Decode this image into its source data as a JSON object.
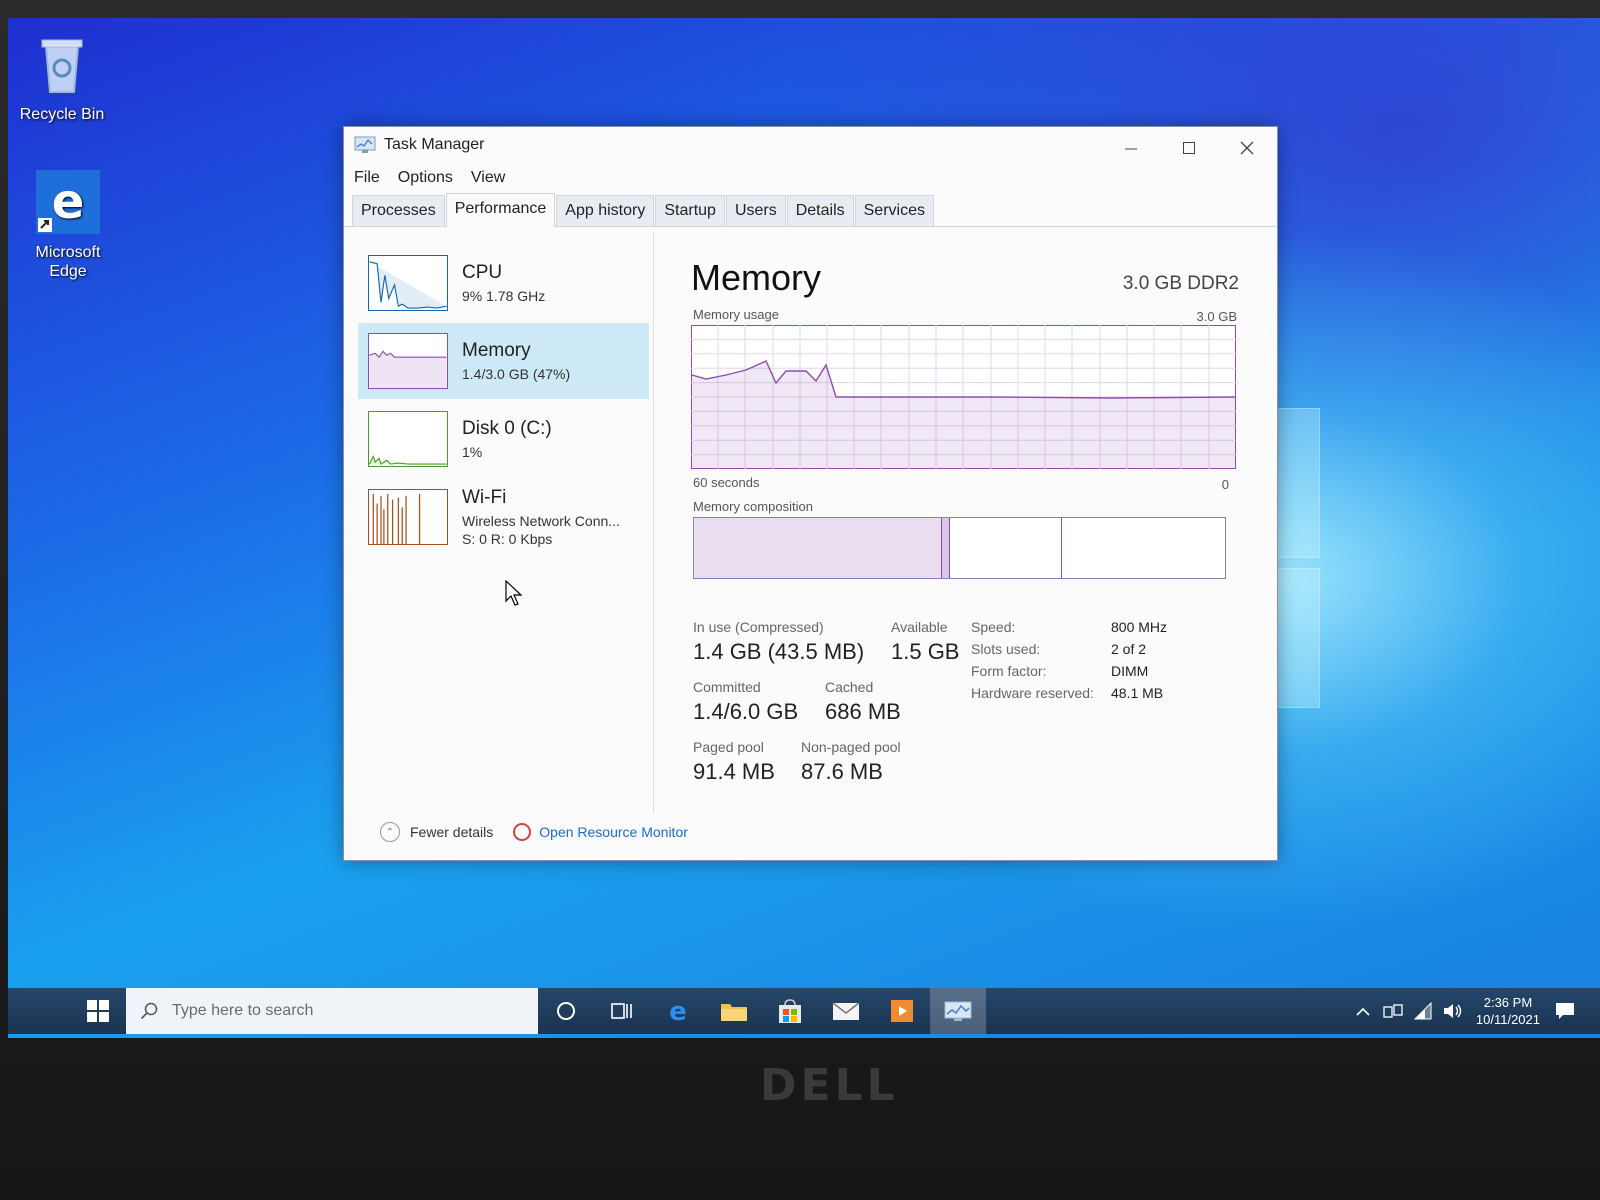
{
  "desktop": {
    "icons": [
      {
        "label": "Recycle Bin"
      },
      {
        "label": "Microsoft\nEdge"
      }
    ]
  },
  "task_manager": {
    "title": "Task Manager",
    "menu": [
      "File",
      "Options",
      "View"
    ],
    "tabs": [
      "Processes",
      "Performance",
      "App history",
      "Startup",
      "Users",
      "Details",
      "Services"
    ],
    "active_tab": "Performance",
    "sidebar": [
      {
        "title": "CPU",
        "line1": "9%  1.78 GHz",
        "line2": ""
      },
      {
        "title": "Memory",
        "line1": "1.4/3.0 GB (47%)",
        "line2": ""
      },
      {
        "title": "Disk 0 (C:)",
        "line1": "1%",
        "line2": ""
      },
      {
        "title": "Wi-Fi",
        "line1": "Wireless Network Conn...",
        "line2": "S: 0  R: 0 Kbps"
      }
    ],
    "main": {
      "title": "Memory",
      "spec": "3.0 GB DDR2",
      "usage_label": "Memory usage",
      "usage_max": "3.0 GB",
      "time_label": "60 seconds",
      "time_min": "0",
      "composition_label": "Memory composition",
      "stats": {
        "in_use_label": "In use (Compressed)",
        "in_use_value": "1.4 GB (43.5 MB)",
        "available_label": "Available",
        "available_value": "1.5 GB",
        "committed_label": "Committed",
        "committed_value": "1.4/6.0 GB",
        "cached_label": "Cached",
        "cached_value": "686 MB",
        "paged_label": "Paged pool",
        "paged_value": "91.4 MB",
        "nonpaged_label": "Non-paged pool",
        "nonpaged_value": "87.6 MB"
      },
      "specs": [
        {
          "k": "Speed:",
          "v": "800 MHz"
        },
        {
          "k": "Slots used:",
          "v": "2 of 2"
        },
        {
          "k": "Form factor:",
          "v": "DIMM"
        },
        {
          "k": "Hardware reserved:",
          "v": "48.1 MB"
        }
      ]
    },
    "footer": {
      "fewer_details": "Fewer details",
      "open_monitor": "Open Resource Monitor"
    }
  },
  "taskbar": {
    "search_placeholder": "Type here to search",
    "time": "2:36 PM",
    "date": "10/11/2021"
  },
  "colors": {
    "memory_accent": "#8b4db0",
    "cpu_accent": "#1168b5",
    "disk_accent": "#4c9a2a",
    "wifi_accent": "#a74f1c",
    "selected_bg": "#cde8f6"
  }
}
